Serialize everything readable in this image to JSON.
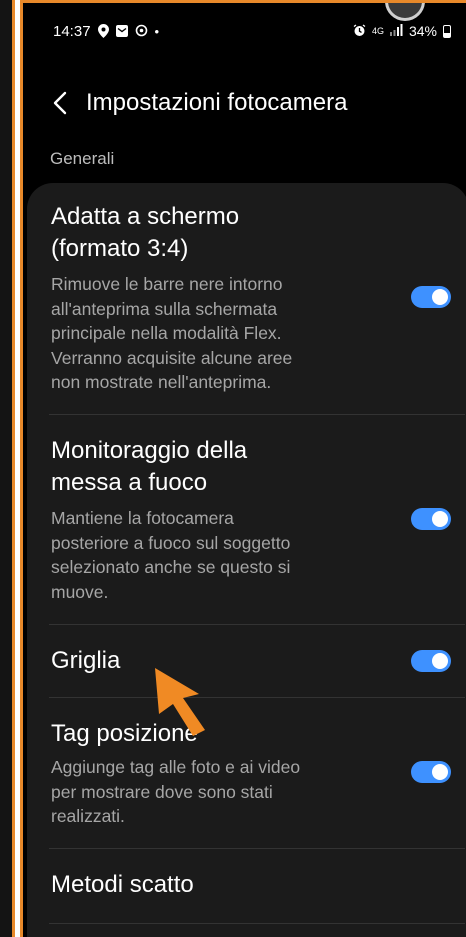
{
  "status_bar": {
    "time": "14:37",
    "left_icons": [
      "location-icon",
      "message-icon",
      "sync-icon",
      "dot-icon"
    ],
    "right_icons": [
      "alarm-icon",
      "data-icon",
      "signal-icon"
    ],
    "network": "4G",
    "battery": "34%"
  },
  "header": {
    "title": "Impostazioni fotocamera",
    "back_icon": "chevron-left-icon"
  },
  "section": {
    "label": "Generali"
  },
  "settings": [
    {
      "title_line1": "Adatta a schermo",
      "title_line2": "(formato 3:4)",
      "desc": [
        "Rimuove le barre nere intorno",
        "all'anteprima sulla schermata",
        "principale nella modalità Flex.",
        "Verranno acquisite alcune aree",
        "non mostrate nell'anteprima."
      ],
      "enabled": true
    },
    {
      "title_line1": "Monitoraggio della",
      "title_line2": "messa a fuoco",
      "desc": [
        "Mantiene la fotocamera",
        "posteriore a fuoco sul soggetto",
        "selezionato anche se questo si",
        "muove."
      ],
      "enabled": true
    },
    {
      "title_line1": "Griglia",
      "enabled": true
    },
    {
      "title_line1": "Tag posizione",
      "desc": [
        "Aggiunge tag alle foto e ai video",
        "per mostrare dove sono stati",
        "realizzati."
      ],
      "enabled": true
    },
    {
      "title_line1": "Metodi scatto"
    }
  ],
  "colors": {
    "background": "#000000",
    "card": "#1b1b1b",
    "toggle_on": "#3e91ff",
    "frame_accent": "#e8892a",
    "annotation_arrow": "#f08a24"
  }
}
